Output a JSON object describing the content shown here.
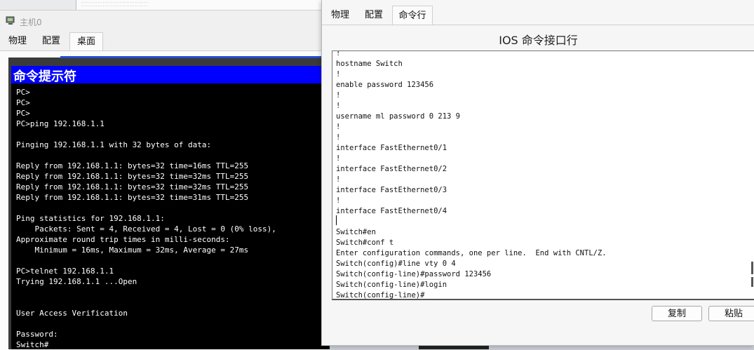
{
  "pc_window": {
    "title": "主机0",
    "tabs": [
      "物理",
      "配置",
      "桌面"
    ],
    "active_tab": "桌面",
    "cmd_title": "命令提示符",
    "cmd_lines": [
      "PC>",
      "PC>",
      "PC>",
      "PC>ping 192.168.1.1",
      "",
      "Pinging 192.168.1.1 with 32 bytes of data:",
      "",
      "Reply from 192.168.1.1: bytes=32 time=16ms TTL=255",
      "Reply from 192.168.1.1: bytes=32 time=32ms TTL=255",
      "Reply from 192.168.1.1: bytes=32 time=32ms TTL=255",
      "Reply from 192.168.1.1: bytes=32 time=31ms TTL=255",
      "",
      "Ping statistics for 192.168.1.1:",
      "    Packets: Sent = 4, Received = 4, Lost = 0 (0% loss),",
      "Approximate round trip times in milli-seconds:",
      "    Minimum = 16ms, Maximum = 32ms, Average = 27ms",
      "",
      "PC>telnet 192.168.1.1",
      "Trying 192.168.1.1 ...Open",
      "",
      "",
      "User Access Verification",
      "",
      "Password:",
      "Switch#"
    ]
  },
  "switch_window": {
    "tabs": [
      "物理",
      "配置",
      "命令行"
    ],
    "active_tab": "命令行",
    "heading": "IOS 命令接口行",
    "terminal_lines": [
      "!",
      "hostname Switch",
      "!",
      "enable password 123456",
      "!",
      "!",
      "username ml password 0 213 9",
      "!",
      "!",
      "interface FastEthernet0/1",
      "!",
      "interface FastEthernet0/2",
      "!",
      "interface FastEthernet0/3",
      "!",
      "interface FastEthernet0/4",
      "",
      "Switch#en",
      "Switch#conf t",
      "Enter configuration commands, one per line.  End with CNTL/Z.",
      "Switch(config)#line vty 0 4",
      "Switch(config-line)#password 123456",
      "Switch(config-line)#login",
      "Switch(config-line)#"
    ],
    "copy_button": "复制",
    "paste_button": "粘贴"
  }
}
